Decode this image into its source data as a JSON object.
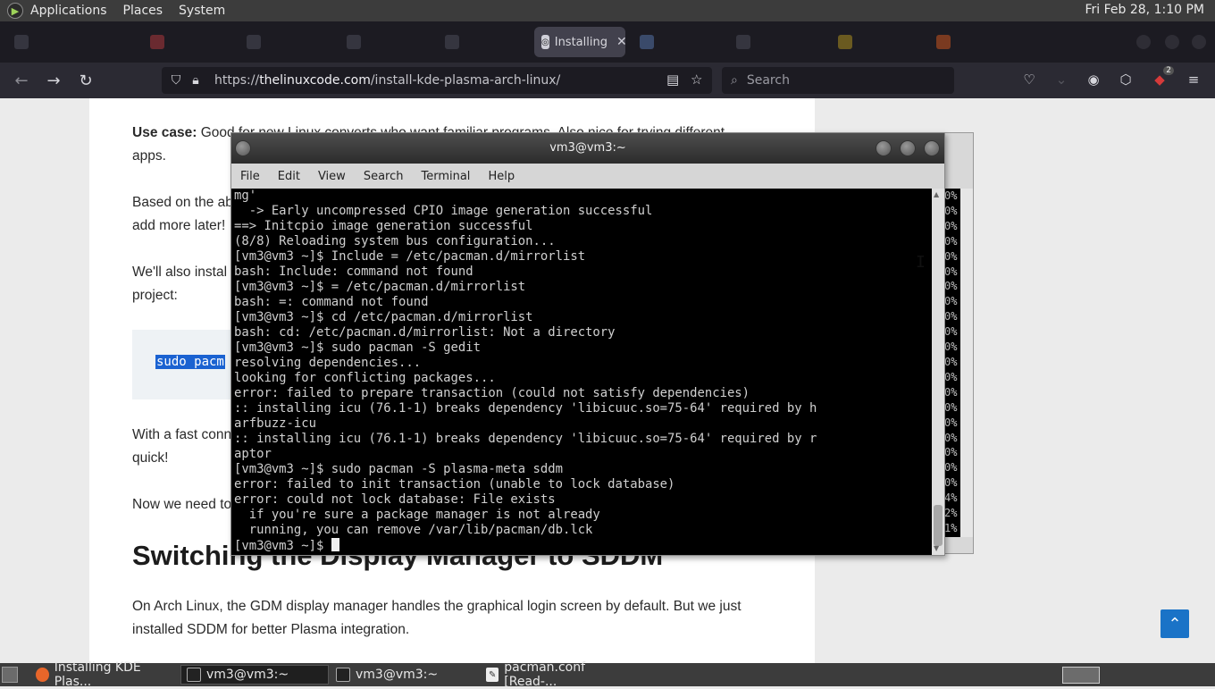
{
  "top_panel": {
    "menus": [
      "Applications",
      "Places",
      "System"
    ],
    "clock": "Fri Feb 28,  1:10 PM"
  },
  "browser": {
    "active_tab": {
      "title": "Installing"
    },
    "url": {
      "prefix": "https://",
      "domain": "thelinuxcode.com",
      "path": "/install-kde-plasma-arch-linux/"
    },
    "search_placeholder": "Search",
    "extension_badge": "2"
  },
  "article": {
    "use_case_label": "Use case:",
    "use_case_text": " Good for new Linux converts who want familiar programs. Also nice for trying different",
    "use_case_cont": "apps.",
    "para2_a": "Based on the ab",
    "para2_b": "add more later!",
    "para3_a": "We'll also instal",
    "para3_b": "project:",
    "code": "sudo pacm",
    "para4_a": "With a fast conn",
    "para4_b": "quick!",
    "para5": "Now we need to",
    "heading": "Switching the Display Manager to SDDM",
    "para6_a": "On Arch Linux, the GDM display manager handles the graphical login screen by default. But we just",
    "para6_b": "installed SDDM for better Plasma integration."
  },
  "terminal": {
    "title": "vm3@vm3:~",
    "menu": [
      "File",
      "Edit",
      "View",
      "Search",
      "Terminal",
      "Help"
    ],
    "lines": [
      "mg'",
      "  -> Early uncompressed CPIO image generation successful",
      "==> Initcpio image generation successful",
      "(8/8) Reloading system bus configuration...",
      "[vm3@vm3 ~]$ Include = /etc/pacman.d/mirrorlist",
      "bash: Include: command not found",
      "[vm3@vm3 ~]$ = /etc/pacman.d/mirrorlist",
      "bash: =: command not found",
      "[vm3@vm3 ~]$ cd /etc/pacman.d/mirrorlist",
      "bash: cd: /etc/pacman.d/mirrorlist: Not a directory",
      "[vm3@vm3 ~]$ sudo pacman -S gedit",
      "resolving dependencies...",
      "looking for conflicting packages...",
      "error: failed to prepare transaction (could not satisfy dependencies)",
      ":: installing icu (76.1-1) breaks dependency 'libicuuc.so=75-64' required by h",
      "arfbuzz-icu",
      ":: installing icu (76.1-1) breaks dependency 'libicuuc.so=75-64' required by r",
      "aptor",
      "[vm3@vm3 ~]$ sudo pacman -S plasma-meta sddm",
      "error: failed to init transaction (unable to lock database)",
      "error: could not lock database: File exists",
      "  if you're sure a package manager is not already",
      "  running, you can remove /var/lib/pacman/db.lck"
    ],
    "prompt": "[vm3@vm3 ~]$ "
  },
  "back_terminal_strip": [
    "0%",
    "0%",
    "0%",
    "0%",
    "0%",
    "0%",
    "0%",
    "0%",
    "0%",
    "0%",
    "0%",
    "0%",
    "0%",
    "0%",
    "0%",
    "0%",
    "0%",
    "0%",
    "0%",
    "0%",
    "4%",
    "2%",
    "1%"
  ],
  "taskbar": {
    "tasks": [
      {
        "label": "Installing KDE Plas...",
        "icon": "firefox-icon"
      },
      {
        "label": "vm3@vm3:~",
        "icon": "terminal-icon"
      },
      {
        "label": "vm3@vm3:~",
        "icon": "terminal-icon"
      },
      {
        "label": "pacman.conf [Read-...",
        "icon": "text-editor-icon"
      }
    ]
  }
}
